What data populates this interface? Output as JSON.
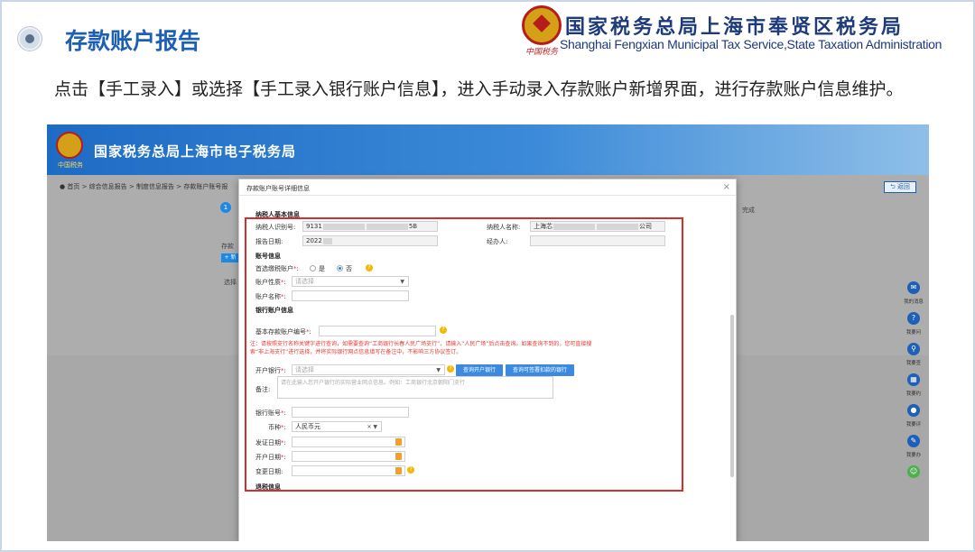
{
  "slide": {
    "title": "存款账户报告",
    "logo_cn": "国家税务总局上海市奉贤区税务局",
    "logo_en": "Shanghai Fengxian Municipal Tax Service,State Taxation  Administration",
    "logo_sig": "中国税务",
    "description": "点击【手工录入】或选择【手工录入银行账户信息】，进入手动录入存款账户新增界面，进行存款账户信息维护。"
  },
  "app": {
    "banner_title": "国家税务总局上海市电子税务局",
    "banner_sig": "中国税务",
    "breadcrumb": [
      "首页",
      "综合信息报告",
      "制度信息报告",
      "存款账户账号报"
    ],
    "back_label": "返回",
    "step_number": "1",
    "bg_label_right": "完成",
    "bg_label_left1": "存款",
    "bg_label_left2": "选择",
    "bg_add_label": "+ 新",
    "right_rail": [
      {
        "icon": "message-icon",
        "label": "我的消息"
      },
      {
        "icon": "question-icon",
        "label": "我要问"
      },
      {
        "icon": "search-icon",
        "label": "我要查"
      },
      {
        "icon": "calendar-icon",
        "label": "我要约"
      },
      {
        "icon": "chat-icon",
        "label": "我要评"
      },
      {
        "icon": "edit-icon",
        "label": "我要办"
      }
    ]
  },
  "modal": {
    "title": "存款账户账号详细信息",
    "close": "×",
    "sections": {
      "basic": "纳税人基本信息",
      "account": "账号信息",
      "bank": "银行账户信息",
      "tax": "退税信息"
    },
    "fields": {
      "taxpayer_id_label": "纳税人识别号:",
      "taxpayer_id_prefix": "9131",
      "taxpayer_id_suffix": "5B",
      "taxpayer_name_label": "纳税人名称:",
      "taxpayer_name_prefix": "上海芯",
      "taxpayer_name_suffix": "公司",
      "report_date_label": "报告日期:",
      "report_date_value": "2022",
      "handler_label": "经办人:",
      "first_account_label": "首选缴税账户",
      "first_account_yes": "是",
      "first_account_no": "否",
      "account_type_label": "账户性质",
      "account_type_placeholder": "请选择",
      "account_name_label": "账户名称",
      "basic_account_no_label": "基本存款账户编号",
      "note": "注：请按照支行名称关键字进行查询，如需要查询“工商银行长春人民广场支行”，请输入“人民广场”后点击查询。如果查询不到的，您可直接搜索“非上海支行”进行选择，并将实际银行网点信息填写在备注中，不影响三方协议签订。",
      "open_bank_label": "开户银行",
      "open_bank_placeholder": "请选择",
      "query_bank_btn": "查询开户银行",
      "query_signed_bank_btn": "查询可签署扣款的银行",
      "remark_label": "备注:",
      "remark_placeholder": "请在此输入您开户银行的实际营业网点信息。例如：工商银行北京朝阳门支行",
      "bank_account_label": "银行账号",
      "currency_label": "币种",
      "currency_value": "人民币元",
      "issue_date_label": "发证日期",
      "open_date_label": "开户日期",
      "change_date_label": "变更日期:"
    }
  },
  "colors": {
    "title_blue": "#1d5fb4",
    "required_red": "#e53935",
    "highlight_red": "#d32f2f"
  }
}
